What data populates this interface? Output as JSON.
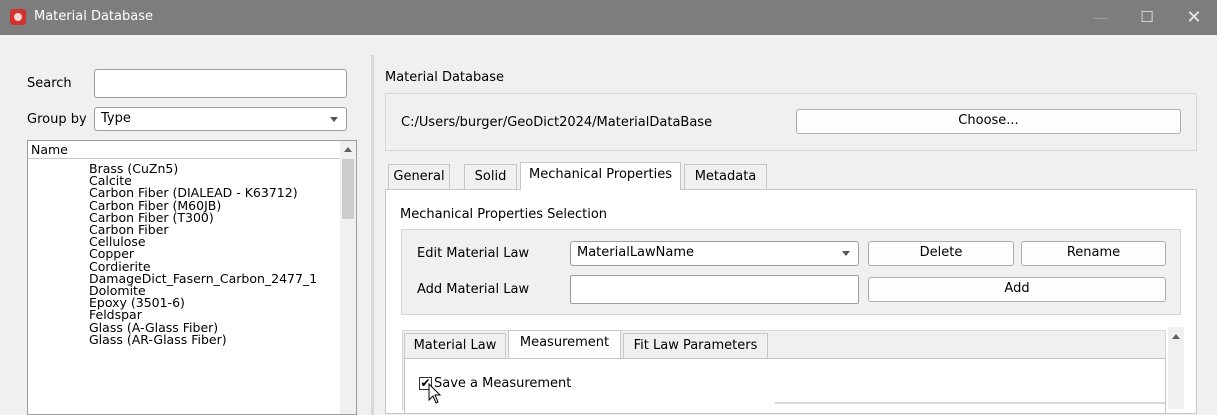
{
  "window": {
    "title": "Material Database",
    "minimize_glyph": "—",
    "maximize_glyph": "☐",
    "close_glyph": "✕"
  },
  "left": {
    "search_label": "Search",
    "search_value": "",
    "groupby_label": "Group by",
    "groupby_value": "Type",
    "list_header": "Name",
    "items": [
      "Brass (CuZn5)",
      "Calcite",
      "Carbon Fiber (DIALEAD - K63712)",
      "Carbon Fiber (M60JB)",
      "Carbon Fiber (T300)",
      "Carbon Fiber",
      "Cellulose",
      "Copper",
      "Cordierite",
      "DamageDict_Fasern_Carbon_2477_1",
      "Dolomite",
      "Epoxy (3501-6)",
      "Feldspar",
      "Glass (A-Glass Fiber)",
      "Glass (AR-Glass Fiber)"
    ]
  },
  "right": {
    "db_label": "Material Database",
    "path": "C:/Users/burger/GeoDict2024/MaterialDataBase",
    "choose_label": "Choose...",
    "tabs": [
      "General",
      "Solid",
      "Mechanical Properties",
      "Metadata"
    ],
    "active_tab": "Mechanical Properties",
    "section_title": "Mechanical Properties Selection",
    "edit_law_label": "Edit Material Law",
    "edit_law_value": "MaterialLawName",
    "delete_label": "Delete",
    "rename_label": "Rename",
    "add_law_label": "Add Material Law",
    "add_law_value": "",
    "add_label": "Add",
    "subtabs": [
      "Material Law",
      "Measurement",
      "Fit Law Parameters"
    ],
    "active_subtab": "Measurement",
    "save_measurement_label": "Save a Measurement",
    "save_measurement_checked": true,
    "check_glyph": "✔"
  },
  "colors": {
    "titlebar": "#7d7d7d",
    "app_icon": "#d1322d"
  }
}
